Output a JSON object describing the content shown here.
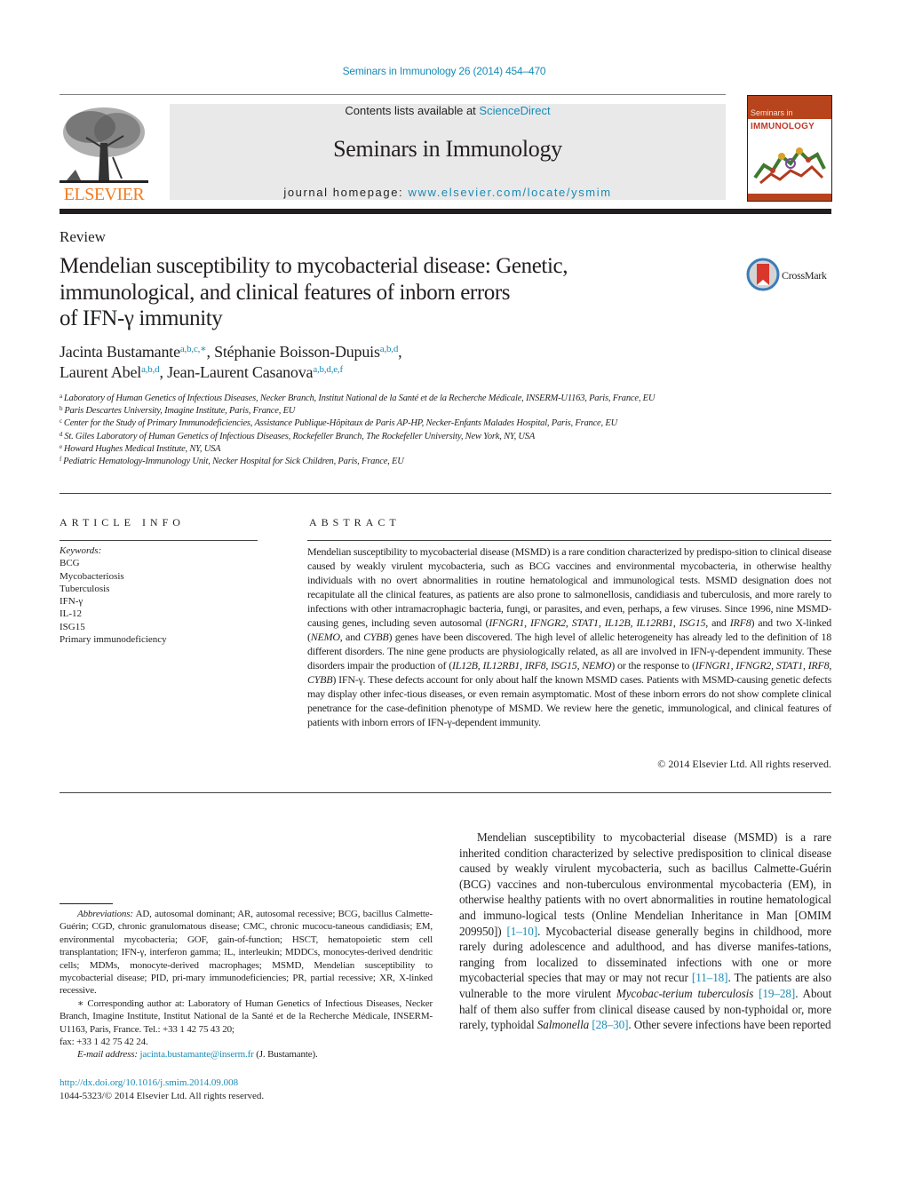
{
  "header": {
    "citation": "Seminars in Immunology 26 (2014) 454–470",
    "publisher_logo_text": "ELSEVIER",
    "contents_prefix": "Contents lists available at ",
    "contents_link": "ScienceDirect",
    "journal_name": "Seminars in Immunology",
    "homepage_prefix": "journal homepage: ",
    "homepage_link": "www.elsevier.com/locate/ysmim",
    "cover": {
      "line1": "Seminars in",
      "line2": "IMMUNOLOGY"
    }
  },
  "colors": {
    "link": "#1a8bb5",
    "elsevier_orange": "#f47b20",
    "masthead_bg": "#e9e9ea"
  },
  "article": {
    "type": "Review",
    "title_lines": [
      "Mendelian susceptibility to mycobacterial disease: Genetic,",
      "immunological, and clinical features of inborn errors",
      "of IFN-γ immunity"
    ],
    "crossmark_label": "CrossMark",
    "authors": [
      {
        "name": "Jacinta Bustamante",
        "sup": "a,b,c,∗",
        "sep": ", "
      },
      {
        "name": "Stéphanie Boisson-Dupuis",
        "sup": "a,b,d",
        "sep": ","
      },
      {
        "name": "Laurent Abel",
        "sup": "a,b,d",
        "sep": ", "
      },
      {
        "name": "Jean-Laurent Casanova",
        "sup": "a,b,d,e,f",
        "sep": ""
      }
    ],
    "affiliations": [
      {
        "key": "a",
        "text": "Laboratory of Human Genetics of Infectious Diseases, Necker Branch, Institut National de la Santé et de la Recherche Médicale, INSERM-U1163, Paris, France, EU"
      },
      {
        "key": "b",
        "text": "Paris Descartes University, Imagine Institute, Paris, France, EU"
      },
      {
        "key": "c",
        "text": "Center for the Study of Primary Immunodeficiencies, Assistance Publique-Hôpitaux de Paris AP-HP, Necker-Enfants Malades Hospital, Paris, France, EU"
      },
      {
        "key": "d",
        "text": "St. Giles Laboratory of Human Genetics of Infectious Diseases, Rockefeller Branch, The Rockefeller University, New York, NY, USA"
      },
      {
        "key": "e",
        "text": "Howard Hughes Medical Institute, NY, USA"
      },
      {
        "key": "f",
        "text": "Pediatric Hematology-Immunology Unit, Necker Hospital for Sick Children, Paris, France, EU"
      }
    ]
  },
  "article_info": {
    "heading": "ARTICLE INFO",
    "keywords_label": "Keywords:",
    "keywords": [
      "BCG",
      "Mycobacteriosis",
      "Tuberculosis",
      "IFN-γ",
      "IL-12",
      "ISG15",
      "Primary immunodeficiency"
    ]
  },
  "abstract": {
    "heading": "ABSTRACT",
    "segments": [
      {
        "t": "Mendelian susceptibility to mycobacterial disease (MSMD) is a rare condition characterized by predispo-­sition to clinical disease caused by weakly virulent mycobacteria, such as BCG vaccines and environmental mycobacteria, in otherwise healthy individuals with no overt abnormalities in routine hematological and immunological tests. MSMD designation does not recapitulate all the clinical features, as patients are also prone to salmonellosis, candidiasis and tuberculosis, and more rarely to infections with other intramacrophagic bacteria, fungi, or parasites, and even, perhaps, a few viruses. Since 1996, nine MSMD-causing genes, including seven autosomal ("
      },
      {
        "t": "IFNGR1",
        "i": true
      },
      {
        "t": ", "
      },
      {
        "t": "IFNGR2",
        "i": true
      },
      {
        "t": ", "
      },
      {
        "t": "STAT1",
        "i": true
      },
      {
        "t": ", "
      },
      {
        "t": "IL12B",
        "i": true
      },
      {
        "t": ", "
      },
      {
        "t": "IL12RB1",
        "i": true
      },
      {
        "t": ", "
      },
      {
        "t": "ISG15",
        "i": true
      },
      {
        "t": ", and "
      },
      {
        "t": "IRF8",
        "i": true
      },
      {
        "t": ") and two X-linked ("
      },
      {
        "t": "NEMO",
        "i": true
      },
      {
        "t": ", and "
      },
      {
        "t": "CYBB",
        "i": true
      },
      {
        "t": ") genes have been discovered. The high level of allelic heterogeneity has already led to the definition of 18 different disorders. The nine gene products are physiologically related, as all are involved in IFN-γ-dependent immunity. These disorders impair the production of ("
      },
      {
        "t": "IL12B",
        "i": true
      },
      {
        "t": ", "
      },
      {
        "t": "IL12RB1",
        "i": true
      },
      {
        "t": ", "
      },
      {
        "t": "IRF8",
        "i": true
      },
      {
        "t": ", "
      },
      {
        "t": "ISG15",
        "i": true
      },
      {
        "t": ", "
      },
      {
        "t": "NEMO",
        "i": true
      },
      {
        "t": ") or the response to ("
      },
      {
        "t": "IFNGR1",
        "i": true
      },
      {
        "t": ", "
      },
      {
        "t": "IFNGR2",
        "i": true
      },
      {
        "t": ", "
      },
      {
        "t": "STAT1",
        "i": true
      },
      {
        "t": ", "
      },
      {
        "t": "IRF8",
        "i": true
      },
      {
        "t": ", "
      },
      {
        "t": "CYBB",
        "i": true
      },
      {
        "t": ") IFN-γ. These defects account for only about half the known MSMD cases. Patients with MSMD-causing genetic defects may display other infec-­tious diseases, or even remain asymptomatic. Most of these inborn errors do not show complete clinical penetrance for the case-definition phenotype of MSMD. We review here the genetic, immunological, and clinical features of patients with inborn errors of IFN-γ-dependent immunity."
      }
    ],
    "copyright": "© 2014 Elsevier Ltd. All rights reserved."
  },
  "footnotes": {
    "abbrev_label": "Abbreviations:",
    "abbrev_text": " AD, autosomal dominant; AR, autosomal recessive; BCG, bacillus Calmette-Guérin; CGD, chronic granulomatous disease; CMC, chronic mucocu-­taneous candidiasis; EM, environmental mycobacteria; GOF, gain-of-function; HSCT, hematopoietic stem cell transplantation; IFN-γ, interferon gamma; IL, interleukin; MDDCs, monocytes-derived dendritic cells; MDMs, monocyte-derived macrophages; MSMD, Mendelian susceptibility to mycobacterial disease; PID, pri-­mary immunodeficiencies; PR, partial recessive; XR, X-linked recessive.",
    "corresponding": "∗ Corresponding author at: Laboratory of Human Genetics of Infectious Diseases, Necker Branch, Imagine Institute, Institut National de la Santé et de la Recherche Médicale, INSERM-U1163, Paris, France. Tel.: +33 1 42 75 43 20;",
    "fax": "fax: +33 1 42 75 42 24.",
    "email_label": "E-mail address:",
    "email": "jacinta.bustamante@inserm.fr",
    "email_suffix": " (J. Bustamante).",
    "doi": "http://dx.doi.org/10.1016/j.smim.2014.09.008",
    "issn_copyright": "1044-5323/© 2014 Elsevier Ltd. All rights reserved."
  },
  "body": {
    "segments": [
      {
        "t": "Mendelian susceptibility to mycobacterial disease (MSMD) is a rare inherited condition characterized by selective predisposition to clinical disease caused by weakly virulent mycobacteria, such as bacillus Calmette-Guérin (BCG) vaccines and non-tuberculous environmental mycobacteria (EM), in otherwise healthy patients with no overt abnormalities in routine hematological and immuno-­logical tests (Online Mendelian Inheritance in Man [OMIM 209950]) "
      },
      {
        "t": "[1–10]",
        "ref": true
      },
      {
        "t": ". Mycobacterial disease generally begins in childhood, more rarely during adolescence and adulthood, and has diverse manifes-­tations, ranging from localized to disseminated infections with one or more mycobacterial species that may or may not recur "
      },
      {
        "t": "[11–18]",
        "ref": true
      },
      {
        "t": ". The patients are also vulnerable to the more virulent "
      },
      {
        "t": "Mycobac-­terium tuberculosis",
        "i": true
      },
      {
        "t": " "
      },
      {
        "t": "[19–28]",
        "ref": true
      },
      {
        "t": ". About half of them also suffer from clinical disease caused by non-typhoidal or, more rarely, typhoidal "
      },
      {
        "t": "Salmonella",
        "i": true
      },
      {
        "t": " "
      },
      {
        "t": "[28–30]",
        "ref": true
      },
      {
        "t": ". Other severe infections have been reported"
      }
    ]
  }
}
